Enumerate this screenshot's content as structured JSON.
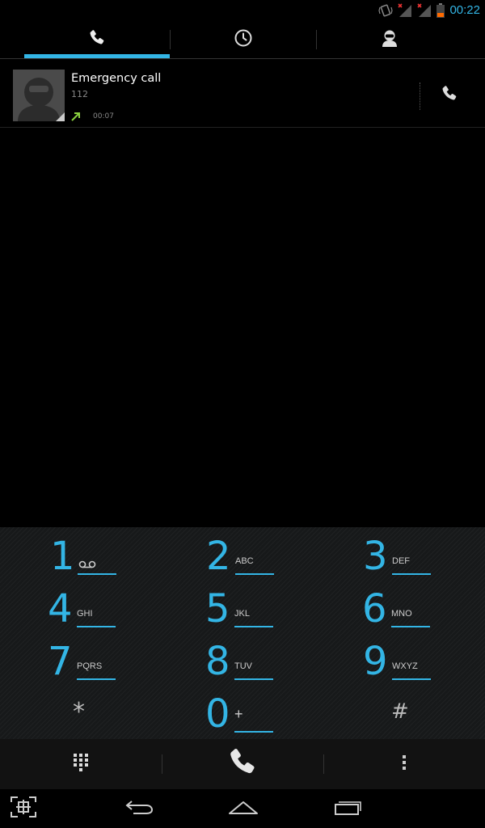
{
  "status_bar": {
    "time": "00:22",
    "icons": [
      "vibrate-icon",
      "signal-no-service-icon",
      "signal-no-service-icon",
      "battery-low-icon"
    ],
    "accent_color": "#33b5e5"
  },
  "tabs": [
    {
      "icon": "phone-icon",
      "selected": true
    },
    {
      "icon": "clock-icon",
      "selected": false
    },
    {
      "icon": "contacts-icon",
      "selected": false
    }
  ],
  "call_log": [
    {
      "name": "Emergency call",
      "number": "112",
      "call_type_icon": "outgoing-call-arrow-icon",
      "duration": "00:07"
    }
  ],
  "dialpad": {
    "keys": [
      {
        "digit": "1",
        "letters": "",
        "icon": "voicemail-icon"
      },
      {
        "digit": "2",
        "letters": "ABC"
      },
      {
        "digit": "3",
        "letters": "DEF"
      },
      {
        "digit": "4",
        "letters": "GHI"
      },
      {
        "digit": "5",
        "letters": "JKL"
      },
      {
        "digit": "6",
        "letters": "MNO"
      },
      {
        "digit": "7",
        "letters": "PQRS"
      },
      {
        "digit": "8",
        "letters": "TUV"
      },
      {
        "digit": "9",
        "letters": "WXYZ"
      },
      {
        "digit": "*",
        "letters": ""
      },
      {
        "digit": "0",
        "letters": "+"
      },
      {
        "digit": "#",
        "letters": ""
      }
    ]
  },
  "action_bar": {
    "left_icon": "dialpad-toggle-icon",
    "center_icon": "call-button-icon",
    "right_icon": "overflow-menu-icon"
  },
  "nav_bar": {
    "icons": [
      "screenshot-icon",
      "back-icon",
      "home-icon",
      "recent-apps-icon"
    ]
  }
}
